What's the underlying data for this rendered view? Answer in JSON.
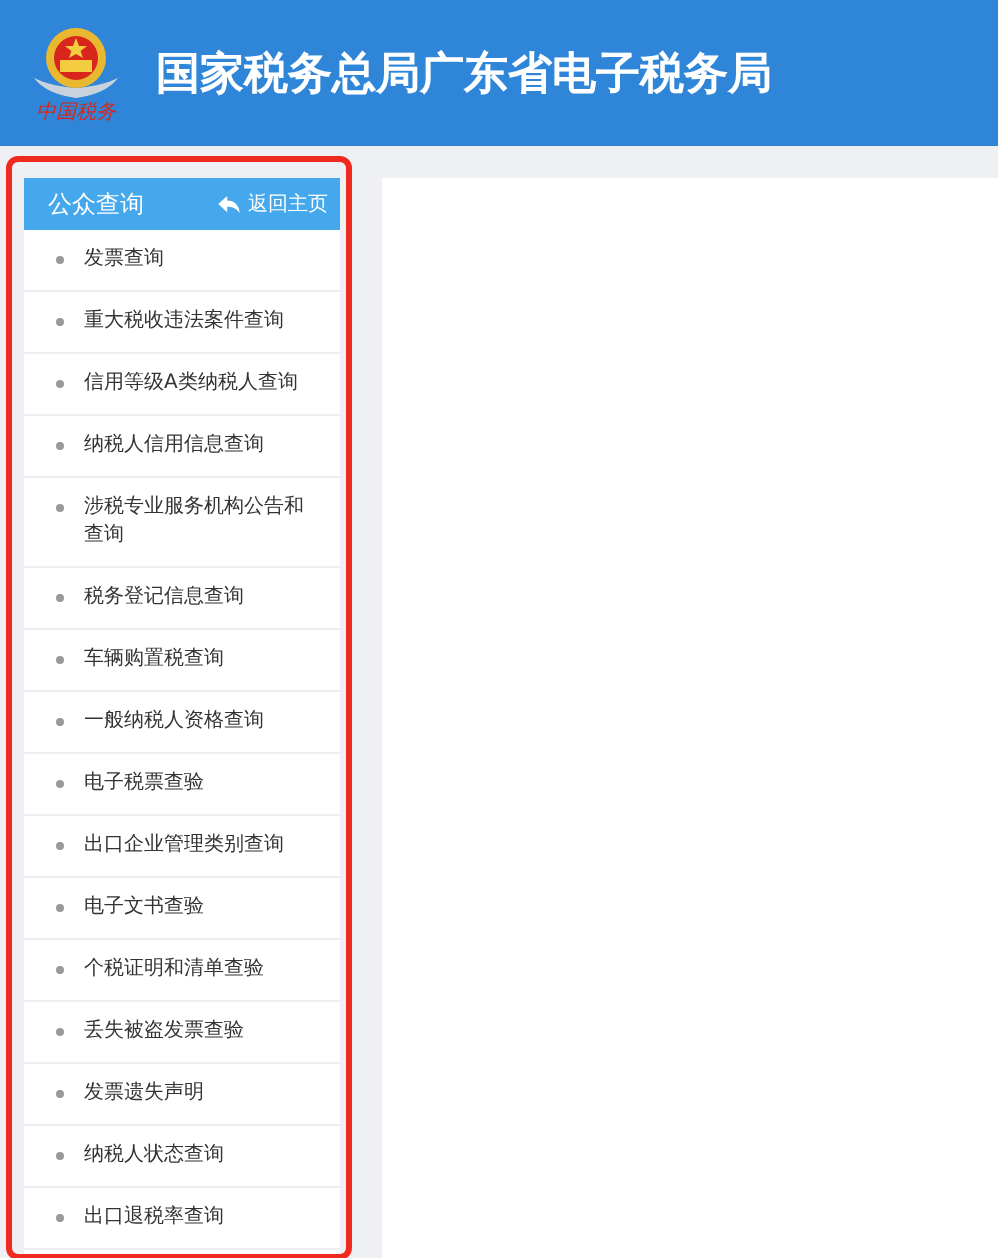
{
  "header": {
    "logo_caption": "中国税务",
    "title": "国家税务总局广东省电子税务局"
  },
  "sidebar": {
    "title": "公众查询",
    "back_link": "返回主页",
    "highlighted": true,
    "items": [
      {
        "label": "发票查询"
      },
      {
        "label": "重大税收违法案件查询"
      },
      {
        "label": "信用等级A类纳税人查询"
      },
      {
        "label": "纳税人信用信息查询"
      },
      {
        "label": "涉税专业服务机构公告和查询"
      },
      {
        "label": "税务登记信息查询"
      },
      {
        "label": "车辆购置税查询"
      },
      {
        "label": "一般纳税人资格查询"
      },
      {
        "label": "电子税票查验"
      },
      {
        "label": "出口企业管理类别查询"
      },
      {
        "label": "电子文书查验"
      },
      {
        "label": "个税证明和清单查验"
      },
      {
        "label": "丢失被盗发票查验"
      },
      {
        "label": "发票遗失声明"
      },
      {
        "label": "纳税人状态查询"
      },
      {
        "label": "出口退税率查询"
      }
    ]
  }
}
